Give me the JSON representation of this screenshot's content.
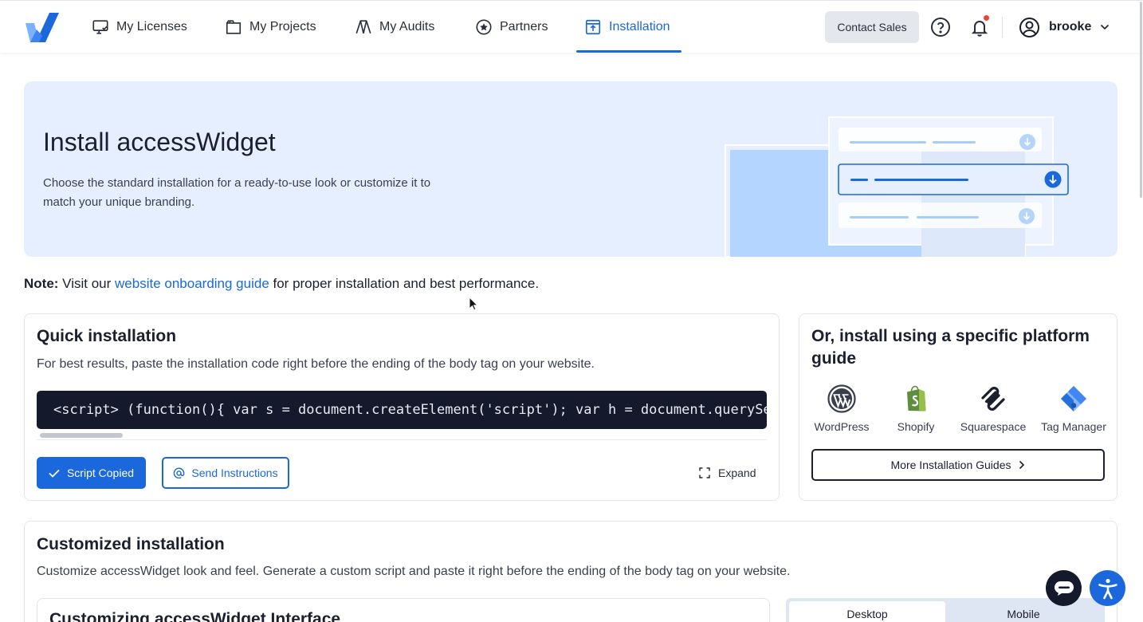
{
  "nav": {
    "items": [
      {
        "label": "My Licenses",
        "icon": "licenses-icon"
      },
      {
        "label": "My Projects",
        "icon": "projects-icon"
      },
      {
        "label": "My Audits",
        "icon": "audits-icon"
      },
      {
        "label": "Partners",
        "icon": "partners-star-icon"
      },
      {
        "label": "Installation",
        "icon": "installation-icon",
        "active": true
      }
    ],
    "contact_sales": "Contact Sales",
    "username": "brooke"
  },
  "hero": {
    "title": "Install accessWidget",
    "description": "Choose the standard installation for a ready-to-use look or customize it to match your unique branding."
  },
  "note": {
    "prefix": "Note:",
    "text_before": " Visit our ",
    "link": "website onboarding guide",
    "text_after": " for proper installation and best performance."
  },
  "quick": {
    "title": "Quick installation",
    "description": "For best results, paste the installation code right before the ending of the body tag on your website.",
    "code": "<script> (function(){ var s = document.createElement('script'); var h = document.querySelector('head') || document.body;",
    "copied_button": "Script Copied",
    "send_button": "Send Instructions",
    "expand_button": "Expand"
  },
  "platform": {
    "title": "Or, install using a specific platform guide",
    "items": [
      {
        "label": "WordPress",
        "icon": "wordpress-icon"
      },
      {
        "label": "Shopify",
        "icon": "shopify-icon"
      },
      {
        "label": "Squarespace",
        "icon": "squarespace-icon"
      },
      {
        "label": "Tag Manager",
        "icon": "tag-manager-icon"
      }
    ],
    "more_button": "More Installation Guides"
  },
  "custom": {
    "title": "Customized installation",
    "description": "Customize accessWidget look and feel. Generate a custom script and paste it right before the ending of the body tag on your website.",
    "sub_title": "Customizing accessWidget Interface",
    "device_tabs": [
      "Desktop",
      "Mobile"
    ],
    "selected_tab": "Desktop"
  },
  "colors": {
    "brand_blue": "#1a68dc",
    "hero_bg": "#e6efff",
    "code_bg": "#141a2c",
    "notification_dot": "#e8453c"
  }
}
